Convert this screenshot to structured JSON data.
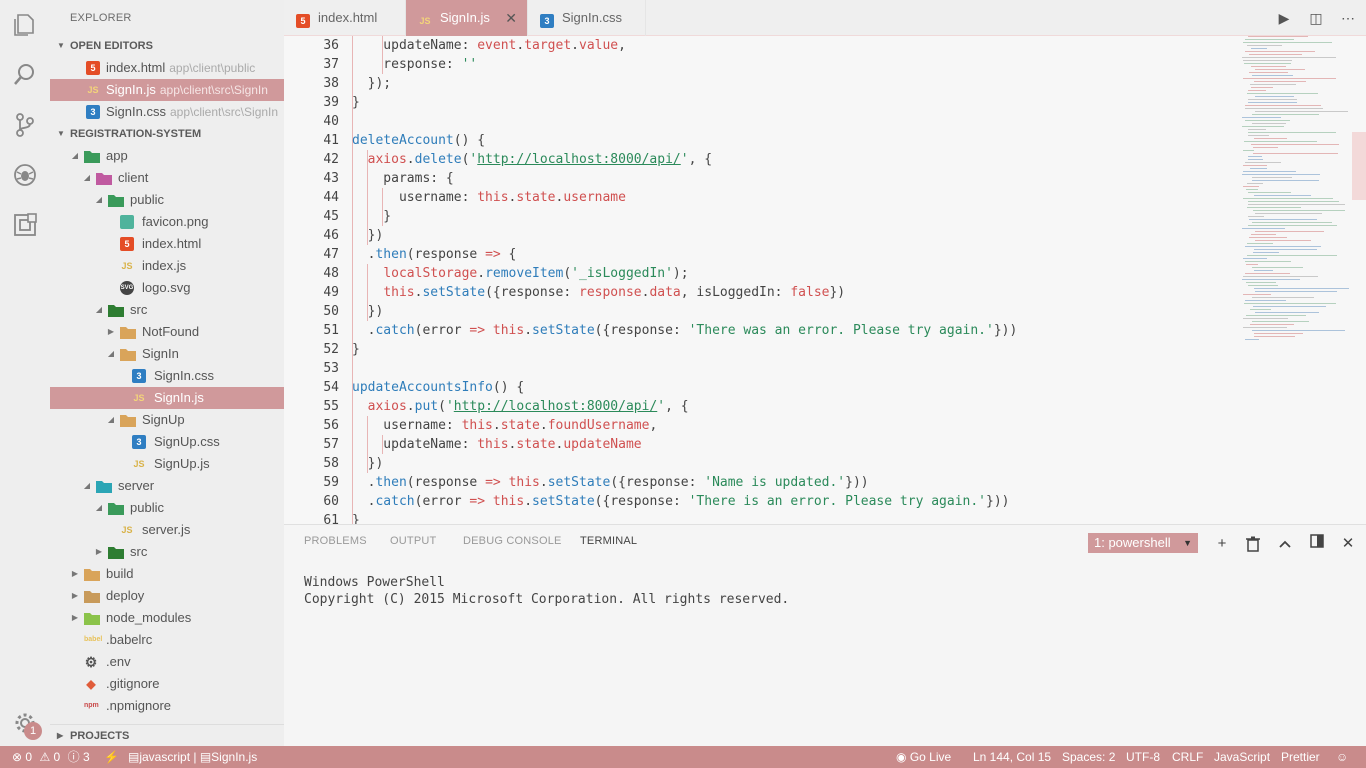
{
  "sidebar": {
    "title": "EXPLORER",
    "open_editors_title": "OPEN EDITORS",
    "project_title": "REGISTRATION-SYSTEM",
    "projects_title": "PROJECTS",
    "open_editors": [
      {
        "name": "index.html",
        "path": "app\\client\\public",
        "icon": "html-file-icon"
      },
      {
        "name": "SignIn.js",
        "path": "app\\client\\src\\SignIn",
        "icon": "js-file-icon"
      },
      {
        "name": "SignIn.css",
        "path": "app\\client\\src\\SignIn",
        "icon": "css-file-icon"
      }
    ],
    "tree": [
      {
        "label": "app",
        "type": "folder-open",
        "color": "#3a9a5a"
      },
      {
        "label": "client",
        "type": "folder-open",
        "color": "#c05aa0"
      },
      {
        "label": "public",
        "type": "folder-open",
        "color": "#3a9a5a"
      },
      {
        "label": "favicon.png",
        "type": "png"
      },
      {
        "label": "index.html",
        "type": "html"
      },
      {
        "label": "index.js",
        "type": "js"
      },
      {
        "label": "logo.svg",
        "type": "svg"
      },
      {
        "label": "src",
        "type": "folder-open",
        "color": "#2e7d32"
      },
      {
        "label": "NotFound",
        "type": "folder",
        "color": "#d9a45a"
      },
      {
        "label": "SignIn",
        "type": "folder-open",
        "color": "#d9a45a"
      },
      {
        "label": "SignIn.css",
        "type": "css"
      },
      {
        "label": "SignIn.js",
        "type": "js"
      },
      {
        "label": "SignUp",
        "type": "folder-open",
        "color": "#d9a45a"
      },
      {
        "label": "SignUp.css",
        "type": "css"
      },
      {
        "label": "SignUp.js",
        "type": "js"
      },
      {
        "label": "server",
        "type": "folder-open",
        "color": "#2ba5b5"
      },
      {
        "label": "public",
        "type": "folder-open",
        "color": "#3a9a5a"
      },
      {
        "label": "server.js",
        "type": "js"
      },
      {
        "label": "src",
        "type": "folder",
        "color": "#2e7d32"
      },
      {
        "label": "build",
        "type": "folder",
        "color": "#d9a45a"
      },
      {
        "label": "deploy",
        "type": "folder",
        "color": "#c89a5a"
      },
      {
        "label": "node_modules",
        "type": "folder",
        "color": "#8bc34a"
      },
      {
        "label": ".babelrc",
        "type": "babel"
      },
      {
        "label": ".env",
        "type": "gear"
      },
      {
        "label": ".gitignore",
        "type": "git"
      },
      {
        "label": ".npmignore",
        "type": "npm"
      }
    ]
  },
  "tabs": [
    {
      "label": "index.html",
      "icon": "html-file-icon"
    },
    {
      "label": "SignIn.js",
      "icon": "js-file-icon"
    },
    {
      "label": "SignIn.css",
      "icon": "css-file-icon"
    }
  ],
  "editor": {
    "line_numbers": [
      "36",
      "37",
      "38",
      "39",
      "40",
      "41",
      "42",
      "43",
      "44",
      "45",
      "46",
      "47",
      "48",
      "49",
      "50",
      "51",
      "52",
      "53",
      "54",
      "55",
      "56",
      "57",
      "58",
      "59",
      "60",
      "61"
    ]
  },
  "panel": {
    "tabs": [
      "PROBLEMS",
      "OUTPUT",
      "DEBUG CONSOLE",
      "TERMINAL"
    ],
    "terminal_selected": "1: powershell",
    "terminal_lines": [
      "Windows PowerShell",
      "Copyright (C) 2015 Microsoft Corporation. All rights reserved."
    ]
  },
  "statusbar": {
    "errors": "0",
    "warnings": "0",
    "infos": "3",
    "language_context": "javascript",
    "file_context": "SignIn.js",
    "go_live": "Go Live",
    "cursor": "Ln 144, Col 15",
    "spaces": "Spaces: 2",
    "encoding": "UTF-8",
    "eol": "CRLF",
    "language": "JavaScript",
    "formatter": "Prettier"
  },
  "activity": {
    "badge": "1"
  },
  "colors": {
    "accent": "#d0999b",
    "statusbar": "#c98b8b"
  }
}
